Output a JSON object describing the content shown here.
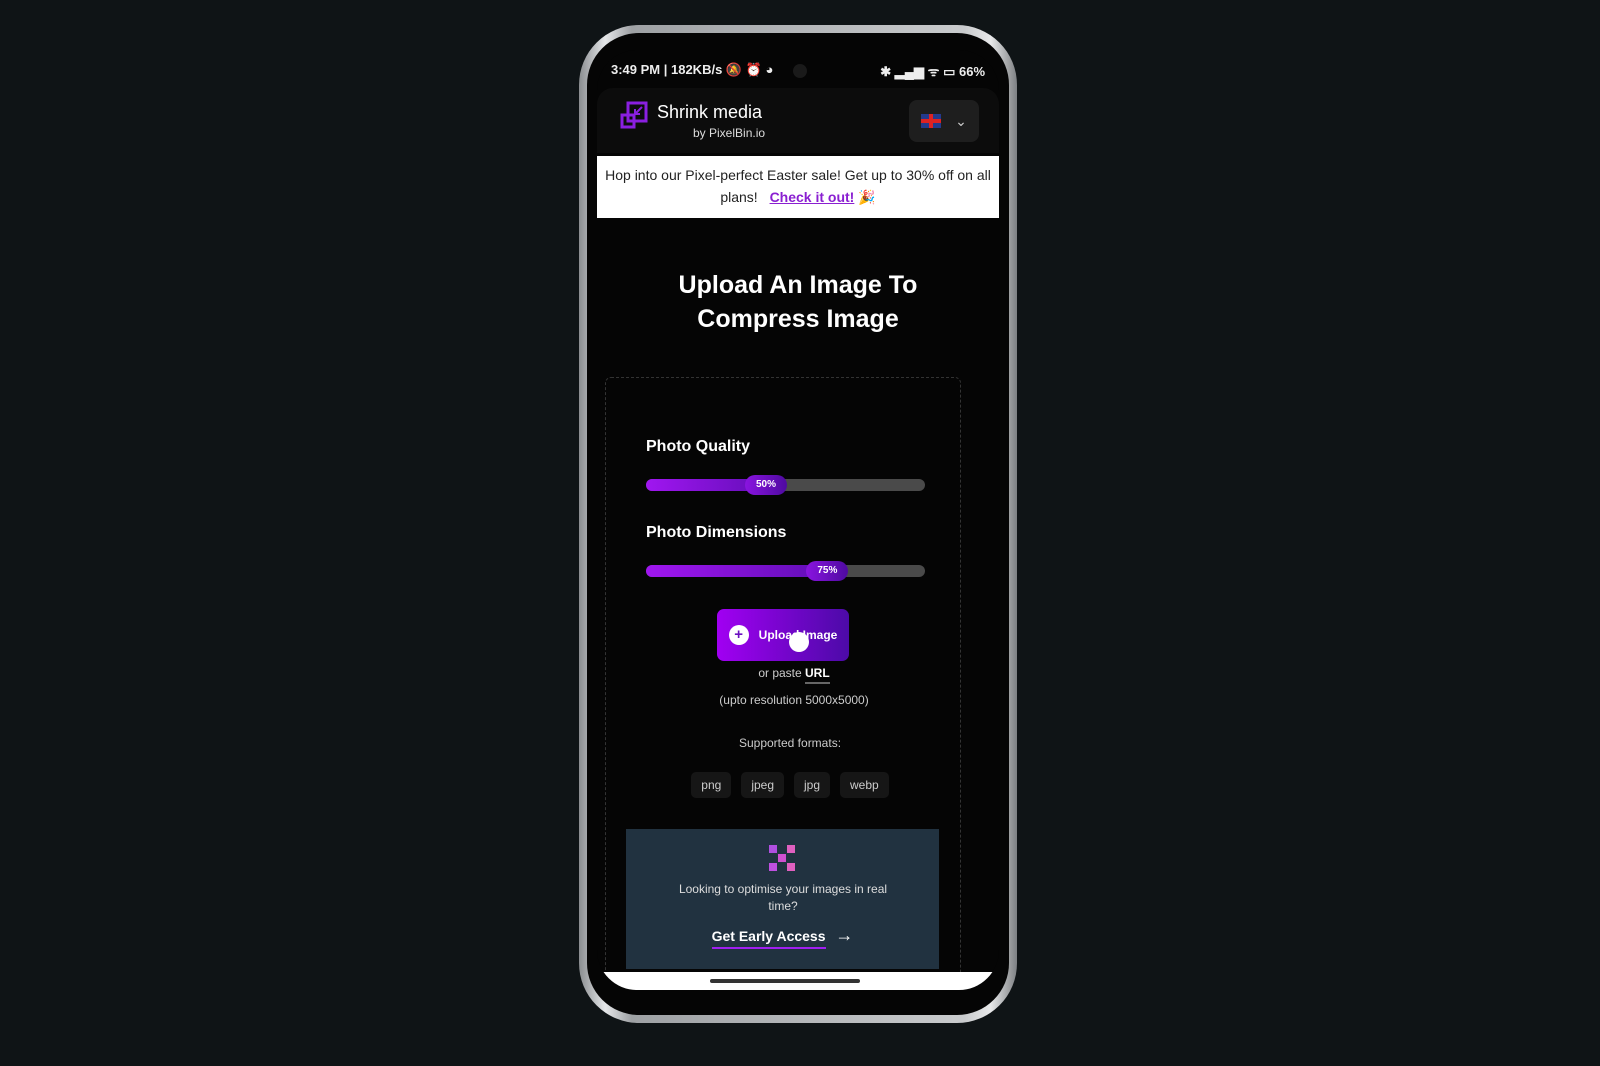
{
  "status_bar": {
    "left": "3:49 PM | 182KB/s 🔕 ⏰ ◕",
    "right": "✱ ▂▄▆ ᯤ ▭ 66%"
  },
  "header": {
    "brand": "Shrink media",
    "byline": "by PixelBin.io",
    "language_flag": "uk-flag-icon",
    "language_chevron": "⌄"
  },
  "promo": {
    "text": "Hop into our Pixel-perfect Easter sale! Get up to 30% off on all plans!",
    "link": "Check it out!",
    "emoji": "🎉"
  },
  "main": {
    "title": "Upload An Image To Compress Image",
    "sliders": [
      {
        "label": "Photo Quality",
        "value": 50,
        "display": "50%"
      },
      {
        "label": "Photo Dimensions",
        "value": 75,
        "display": "75%"
      }
    ],
    "upload_button": "Upload Image",
    "upload_icon": "+",
    "or_paste": "or paste",
    "url_link": "URL",
    "resolution": "(upto resolution 5000x5000)",
    "supported_label": "Supported formats:",
    "formats": [
      "png",
      "jpeg",
      "jpg",
      "webp"
    ]
  },
  "promo2": {
    "text": "Looking to optimise your images in real time?",
    "cta": "Get Early Access",
    "arrow": "→"
  },
  "colors": {
    "accent": "#a016f0",
    "background": "#050505",
    "promo2_bg": "#213240"
  }
}
